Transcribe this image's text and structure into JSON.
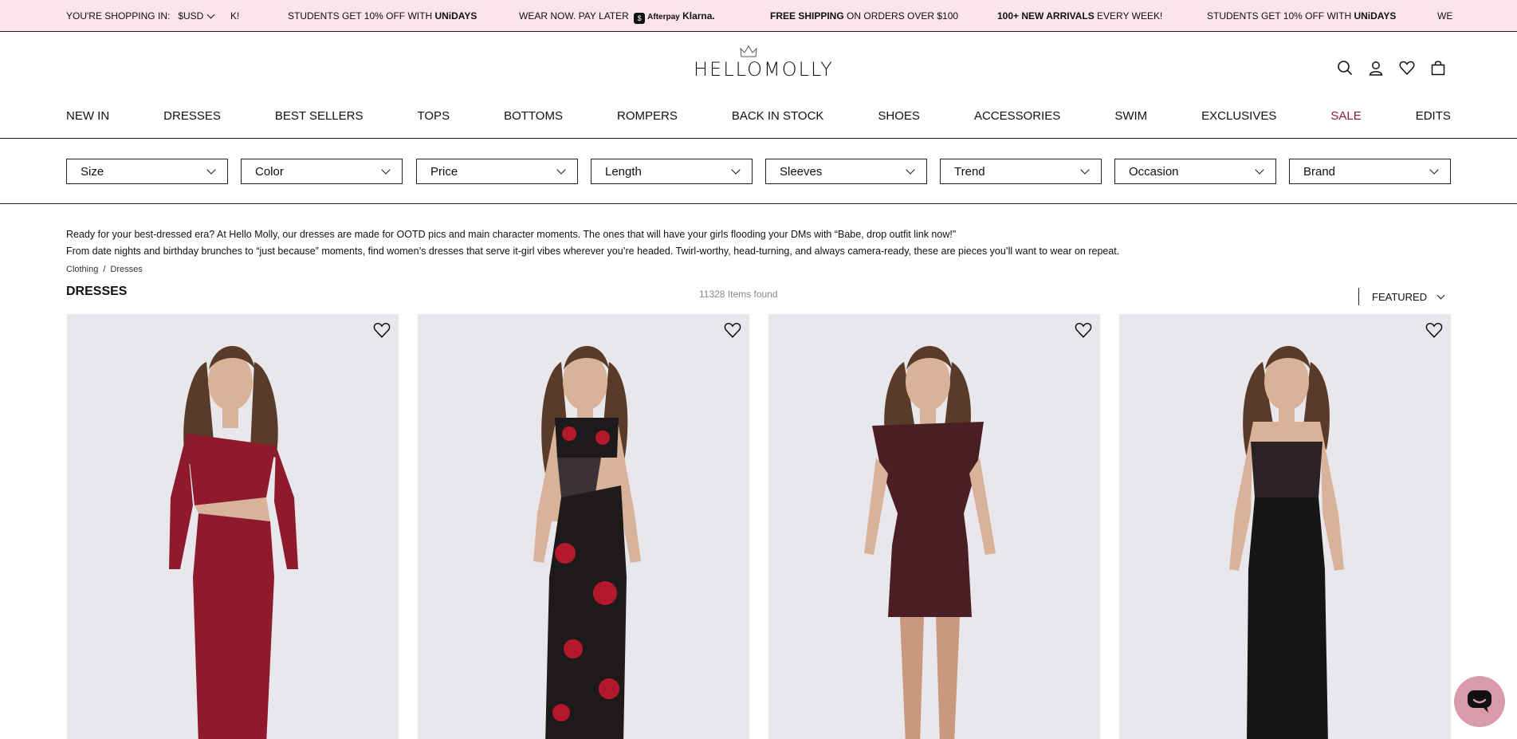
{
  "announcement": {
    "currency_label": "YOU'RE SHOPPING IN:",
    "currency_value": "$USD",
    "fragment_left": "K!",
    "promo1_text": "STUDENTS GET 10% OFF WITH",
    "promo1_brand": "UNiDAYS",
    "promo2_text": "WEAR NOW. PAY LATER",
    "promo2_afterpay": "Afterpay",
    "promo2_klarna": "Klarna.",
    "promo3_bold": "FREE SHIPPING",
    "promo3_text": "ON ORDERS OVER $100",
    "promo4_bold": "100+ NEW ARRIVALS",
    "promo4_text": "EVERY WEEK!",
    "promo5_text": "STUDENTS GET 10% OFF WITH",
    "promo5_brand": "UNiDAYS",
    "fragment_right": "WE"
  },
  "header": {
    "logo": "HELLOMOLLY",
    "icons": [
      "search-icon",
      "account-icon",
      "wishlist-icon",
      "bag-icon"
    ]
  },
  "nav": {
    "items": [
      "NEW IN",
      "DRESSES",
      "BEST SELLERS",
      "TOPS",
      "BOTTOMS",
      "ROMPERS",
      "BACK IN STOCK",
      "SHOES",
      "ACCESSORIES",
      "SWIM",
      "EXCLUSIVES",
      "SALE",
      "EDITS"
    ],
    "sale_color": "#8a1c2b"
  },
  "filters": [
    "Size",
    "Color",
    "Price",
    "Length",
    "Sleeves",
    "Trend",
    "Occasion",
    "Brand"
  ],
  "intro": {
    "line1": "Ready for your best-dressed era? At Hello Molly, our dresses are made for OOTD pics and main character moments. The ones that will have your girls flooding your DMs with “Babe, drop outfit link now!”",
    "line2": "From date nights and birthday brunches to “just because” moments, find women’s dresses that serve it-girl vibes wherever you’re headed. Twirl-worthy, head-turning, and always camera-ready, these are pieces you’ll want to wear on repeat."
  },
  "breadcrumb": [
    "Clothing",
    "/",
    "Dresses"
  ],
  "listing": {
    "title": "DRESSES",
    "count": "11328 Items found",
    "sort_label": "FEATURED"
  },
  "products": [
    {
      "dress_color": "#8e1a2c",
      "style": "one-shoulder-lace-maxi"
    },
    {
      "dress_color": "#1e1a1c",
      "accent_color": "#b3192b",
      "style": "rose-print-cutout-maxi"
    },
    {
      "dress_color": "#4a1e24",
      "style": "leather-mini"
    },
    {
      "dress_color": "#151515",
      "style": "lace-corset-maxi"
    }
  ],
  "colors": {
    "announce_bg": "#fbe4ee",
    "chat_bg": "#d99aa9"
  }
}
